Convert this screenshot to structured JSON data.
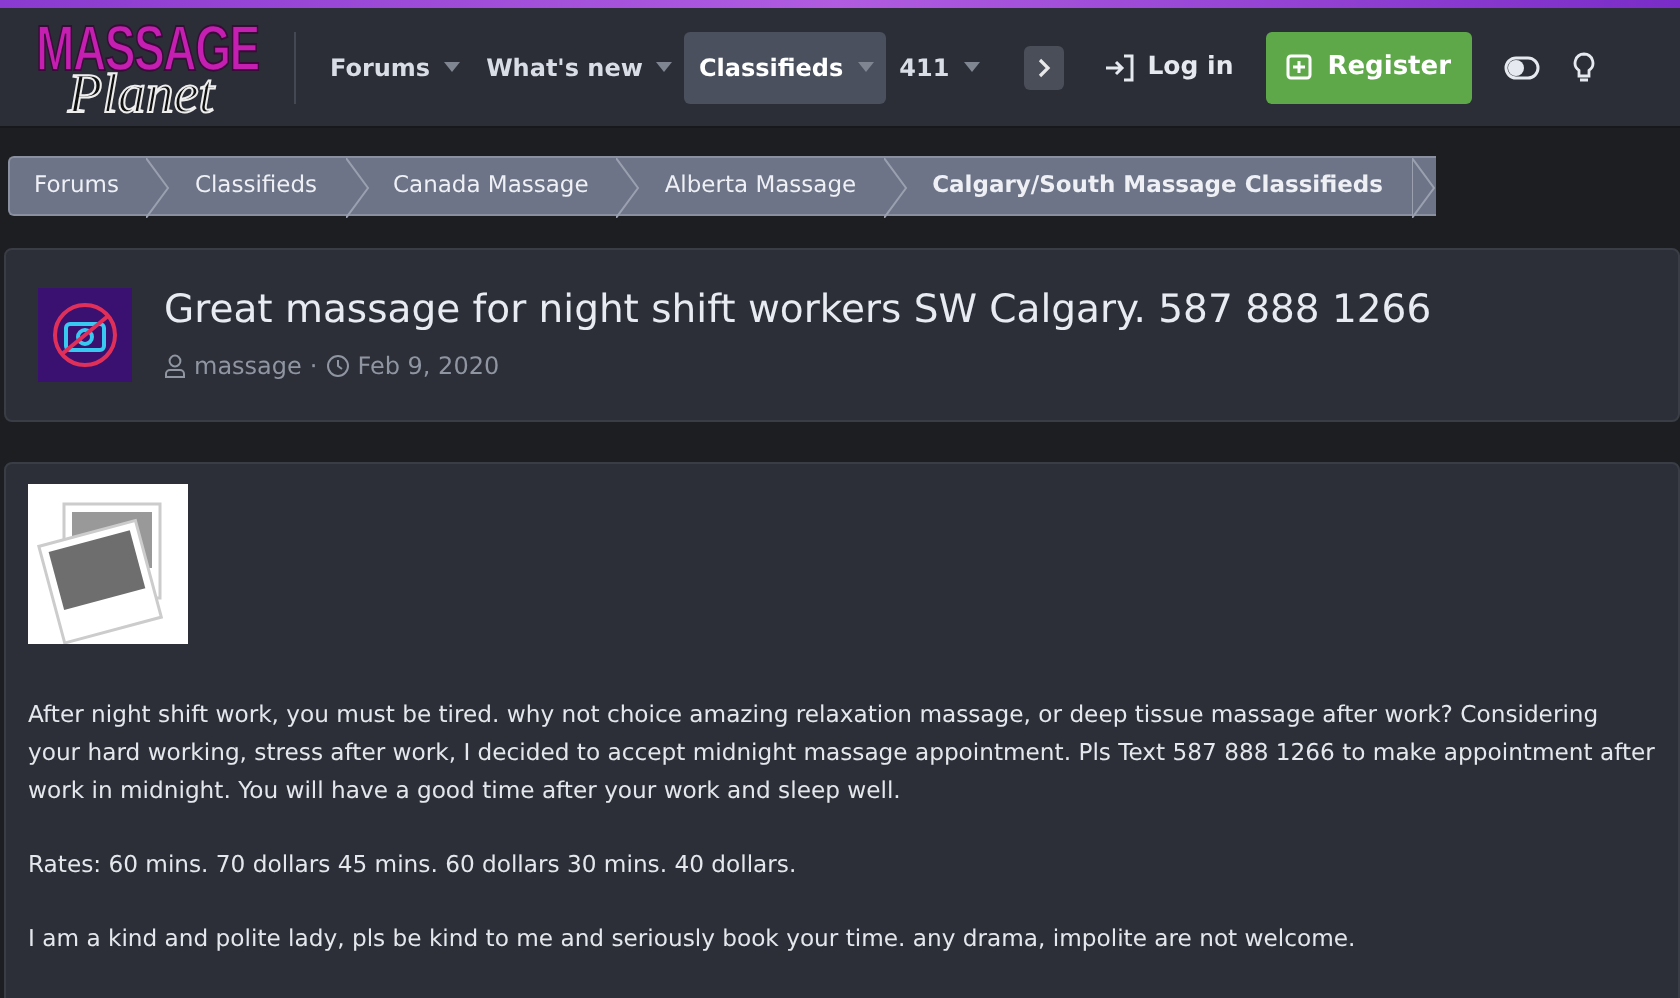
{
  "logo": {
    "line1": "MASSAGE",
    "line2": "Planet"
  },
  "nav": [
    {
      "label": "Forums",
      "selected": false
    },
    {
      "label": "What's new",
      "selected": false
    },
    {
      "label": "Classifieds",
      "selected": true
    },
    {
      "label": "411",
      "selected": false
    }
  ],
  "login": "Log in",
  "register": "Register",
  "breadcrumbs": [
    {
      "label": "Forums",
      "current": false
    },
    {
      "label": "Classifieds",
      "current": false
    },
    {
      "label": "Canada Massage",
      "current": false
    },
    {
      "label": "Alberta Massage",
      "current": false
    },
    {
      "label": "Calgary/South Massage Classifieds",
      "current": true
    }
  ],
  "thread": {
    "title": "Great massage for night shift workers SW Calgary. 587 888 1266",
    "author": "massage",
    "separator": "·",
    "date": "Feb 9, 2020"
  },
  "post": {
    "paragraphs": [
      "After night shift work, you must be tired. why not choice amazing relaxation massage, or deep tissue massage after work? Considering your hard working, stress after work, I decided to accept midnight massage appointment. Pls Text 587 888 1266 to make appointment after work in midnight. You will have a good time after your work and sleep well.",
      "Rates: 60 mins. 70 dollars 45 mins. 60 dollars 30 mins. 40 dollars.",
      "I am a kind and polite lady, pls be kind to me and seriously book your time. any drama, impolite are not welcome."
    ]
  }
}
